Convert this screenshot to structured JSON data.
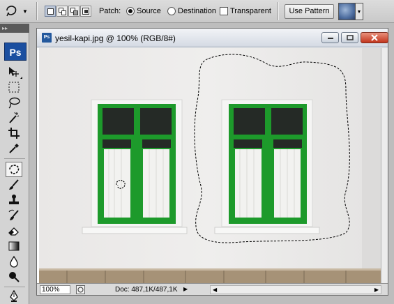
{
  "options_bar": {
    "tool_preset_icon": "patch-tool-icon",
    "selection_modes": [
      "new-selection",
      "add-to-selection",
      "subtract-from-selection",
      "intersect-selection"
    ],
    "patch_label": "Patch:",
    "source_label": "Source",
    "destination_label": "Destination",
    "transparent_label": "Transparent",
    "patch_mode": "Source",
    "transparent_checked": false,
    "use_pattern_label": "Use Pattern"
  },
  "toolbox": {
    "logo_text": "Ps",
    "tools": [
      {
        "name": "move-tool-icon"
      },
      {
        "name": "marquee-tool-icon"
      },
      {
        "name": "lasso-tool-icon"
      },
      {
        "name": "magic-wand-tool-icon"
      },
      {
        "name": "crop-tool-icon"
      },
      {
        "name": "eyedropper-tool-icon"
      },
      {
        "name": "patch-tool-icon",
        "selected": true
      },
      {
        "name": "brush-tool-icon"
      },
      {
        "name": "clone-stamp-tool-icon"
      },
      {
        "name": "history-brush-tool-icon"
      },
      {
        "name": "eraser-tool-icon"
      },
      {
        "name": "gradient-tool-icon"
      },
      {
        "name": "blur-tool-icon"
      },
      {
        "name": "dodge-tool-icon"
      },
      {
        "name": "pen-tool-icon"
      },
      {
        "name": "type-tool-icon"
      }
    ]
  },
  "document": {
    "title": "yesil-kapi.jpg @ 100% (RGB/8#)",
    "icon_text": "Ps",
    "zoom": "100%",
    "doc_info": "Doc: 487,1K/487,1K",
    "colors": {
      "window_frame": "#5aa633",
      "curtain": "#f4f4f2",
      "wall": "#ecebea"
    }
  }
}
